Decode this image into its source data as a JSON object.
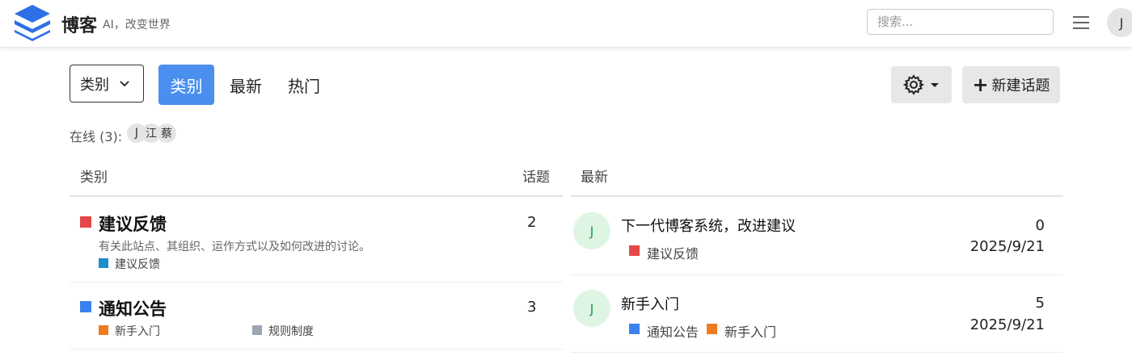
{
  "header": {
    "site_title": "博客",
    "tagline": "AI，改变世界",
    "search_placeholder": "搜索...",
    "user_avatar_letter": "J",
    "icons": {
      "logo": "stacked-layers-logo",
      "menu": "hamburger-icon"
    },
    "accent_color": "#3b6fe0"
  },
  "nav": {
    "category_dropdown_label": "类别",
    "tabs": [
      {
        "label": "类别",
        "active": true
      },
      {
        "label": "最新",
        "active": false
      },
      {
        "label": "热门",
        "active": false
      }
    ],
    "new_topic_label": "新建话题",
    "active_color": "#4a8fef"
  },
  "online": {
    "label": "在线 (3):",
    "users": [
      "J",
      "江",
      "蔡"
    ]
  },
  "categories_table": {
    "header_category": "类别",
    "header_topics": "话题",
    "rows": [
      {
        "name": "建议反馈",
        "color": "#e54848",
        "description": "有关此站点、其组织、运作方式以及如何改进的讨论。",
        "subcategories": [
          {
            "label": "建议反馈",
            "color": "#1a8fc8"
          }
        ],
        "topics": "2"
      },
      {
        "name": "通知公告",
        "color": "#3b82f0",
        "description": "",
        "subcategories": [
          {
            "label": "新手入门",
            "color": "#f07a1f"
          },
          {
            "label": "规则制度",
            "color": "#9aa6b2"
          }
        ],
        "topics": "3"
      }
    ]
  },
  "latest": {
    "header": "最新",
    "topics": [
      {
        "avatar": "J",
        "title": "下一代博客系统，改进建议",
        "tags": [
          {
            "label": "建议反馈",
            "color": "#e54848"
          }
        ],
        "replies": "0",
        "date": "2025/9/21"
      },
      {
        "avatar": "J",
        "title": "新手入门",
        "tags": [
          {
            "label": "通知公告",
            "color": "#3b82f0"
          },
          {
            "label": "新手入门",
            "color": "#f07a1f"
          }
        ],
        "replies": "5",
        "date": "2025/9/21"
      }
    ]
  }
}
